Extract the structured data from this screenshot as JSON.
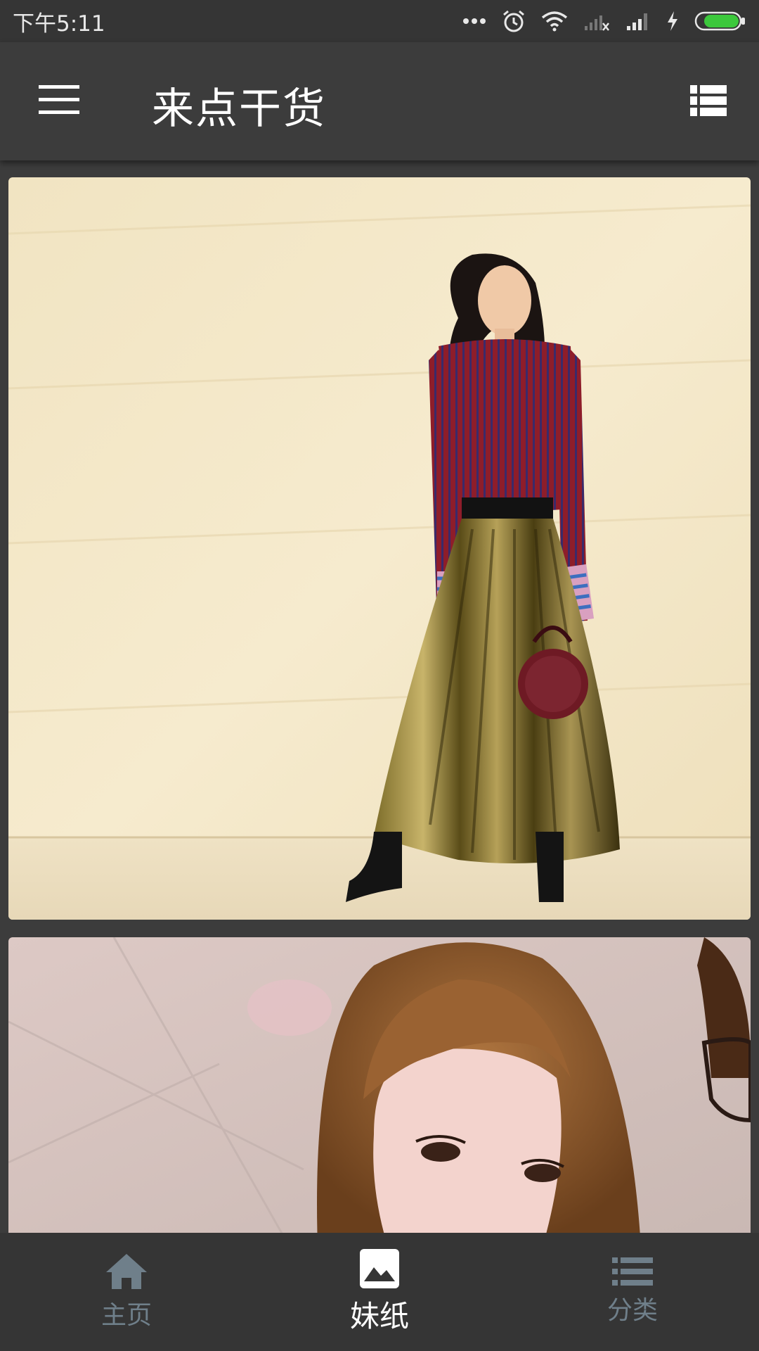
{
  "status_bar": {
    "time": "下午5:11",
    "icons": [
      "more-dots-icon",
      "alarm-icon",
      "wifi-icon",
      "signal-no-sim-icon",
      "signal-icon",
      "charging-icon",
      "battery-icon"
    ]
  },
  "app_bar": {
    "title": "来点干货",
    "left_icon": "menu-icon",
    "right_icon": "list-view-icon"
  },
  "feed": {
    "items": [
      {
        "type": "photo",
        "subject": "woman-red-striped-sweater-gold-pleated-skirt"
      },
      {
        "type": "photo",
        "subject": "woman-short-brown-hair-closeup"
      }
    ]
  },
  "bottom_nav": {
    "items": [
      {
        "label": "主页",
        "icon": "home-icon",
        "active": false
      },
      {
        "label": "妹纸",
        "icon": "image-icon",
        "active": true
      },
      {
        "label": "分类",
        "icon": "category-list-icon",
        "active": false
      }
    ]
  },
  "colors": {
    "app_bar_bg": "#3c3c3c",
    "status_bar_bg": "#353535",
    "inactive_nav": "#6f7f8a",
    "active_nav": "#ffffff",
    "battery_fill": "#3cc83c"
  }
}
